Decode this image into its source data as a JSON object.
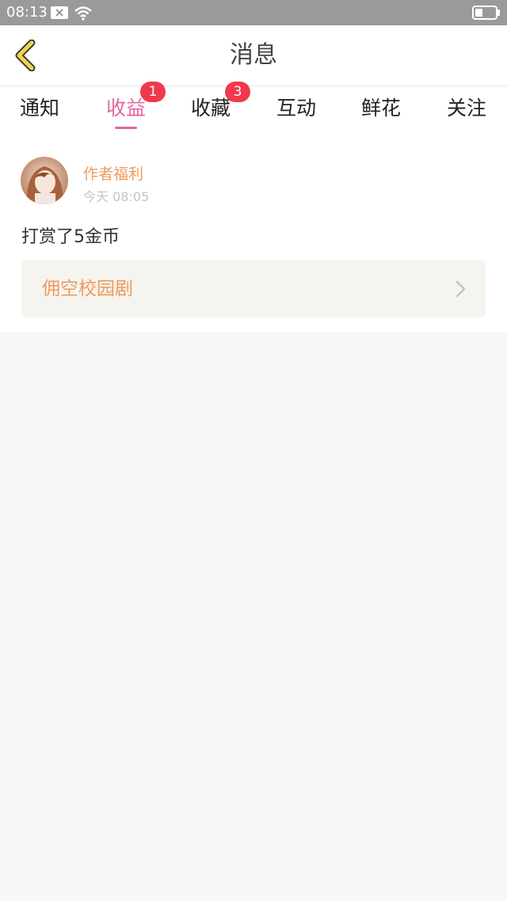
{
  "status_bar": {
    "time": "08:13"
  },
  "header": {
    "title": "消息"
  },
  "tabs": [
    {
      "label": "通知",
      "badge": ""
    },
    {
      "label": "收益",
      "badge": "1",
      "active": true
    },
    {
      "label": "收藏",
      "badge": "3"
    },
    {
      "label": "互动",
      "badge": ""
    },
    {
      "label": "鲜花",
      "badge": ""
    },
    {
      "label": "关注",
      "badge": ""
    }
  ],
  "message": {
    "sender": "作者福利",
    "time": "今天 08:05",
    "body": "打赏了5金币",
    "link_title": "佣空校园剧"
  },
  "colors": {
    "accent": "#e367a1",
    "badge": "#f0394b",
    "sender": "#ef9a5a",
    "back_arrow": "#f2d44a"
  }
}
